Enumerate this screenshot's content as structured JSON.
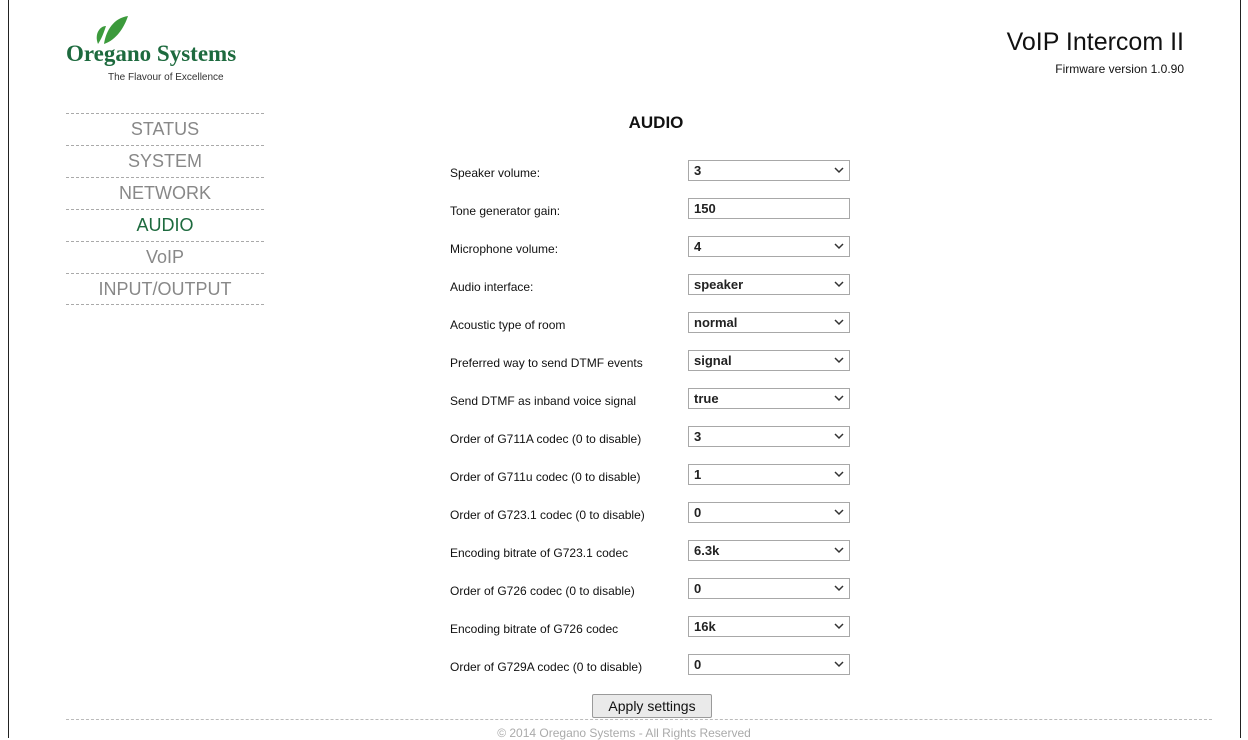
{
  "brand": {
    "name": "Oregano Systems",
    "tagline": "The Flavour of Excellence",
    "color": "#1d6a3e"
  },
  "header": {
    "title": "VoIP Intercom II",
    "firmware": "Firmware version 1.0.90"
  },
  "menu": {
    "items": [
      {
        "label": "STATUS",
        "active": false
      },
      {
        "label": "SYSTEM",
        "active": false
      },
      {
        "label": "NETWORK",
        "active": false
      },
      {
        "label": "AUDIO",
        "active": true
      },
      {
        "label": "VoIP",
        "active": false
      },
      {
        "label": "INPUT/OUTPUT",
        "active": false
      }
    ]
  },
  "section": {
    "title": "AUDIO"
  },
  "fields": [
    {
      "label": "Speaker volume:",
      "value": "3",
      "type": "select"
    },
    {
      "label": "Tone generator gain:",
      "value": "150",
      "type": "text"
    },
    {
      "label": "Microphone volume:",
      "value": "4",
      "type": "select"
    },
    {
      "label": "Audio interface:",
      "value": "speaker",
      "type": "select"
    },
    {
      "label": "Acoustic type of room",
      "value": "normal",
      "type": "select"
    },
    {
      "label": "Preferred way to send DTMF events",
      "value": "signal",
      "type": "select"
    },
    {
      "label": "Send DTMF as inband voice signal",
      "value": "true",
      "type": "select"
    },
    {
      "label": "Order of G711A codec (0 to disable)",
      "value": "3",
      "type": "select"
    },
    {
      "label": "Order of G711u codec (0 to disable)",
      "value": "1",
      "type": "select"
    },
    {
      "label": "Order of G723.1 codec (0 to disable)",
      "value": "0",
      "type": "select"
    },
    {
      "label": "Encoding bitrate of G723.1 codec",
      "value": "6.3k",
      "type": "select"
    },
    {
      "label": "Order of G726 codec (0 to disable)",
      "value": "0",
      "type": "select"
    },
    {
      "label": "Encoding bitrate of G726 codec",
      "value": "16k",
      "type": "select"
    },
    {
      "label": "Order of G729A codec (0 to disable)",
      "value": "0",
      "type": "select"
    }
  ],
  "actions": {
    "apply_label": "Apply settings"
  },
  "footer": {
    "copyright": "© 2014 Oregano Systems - All Rights Reserved"
  }
}
